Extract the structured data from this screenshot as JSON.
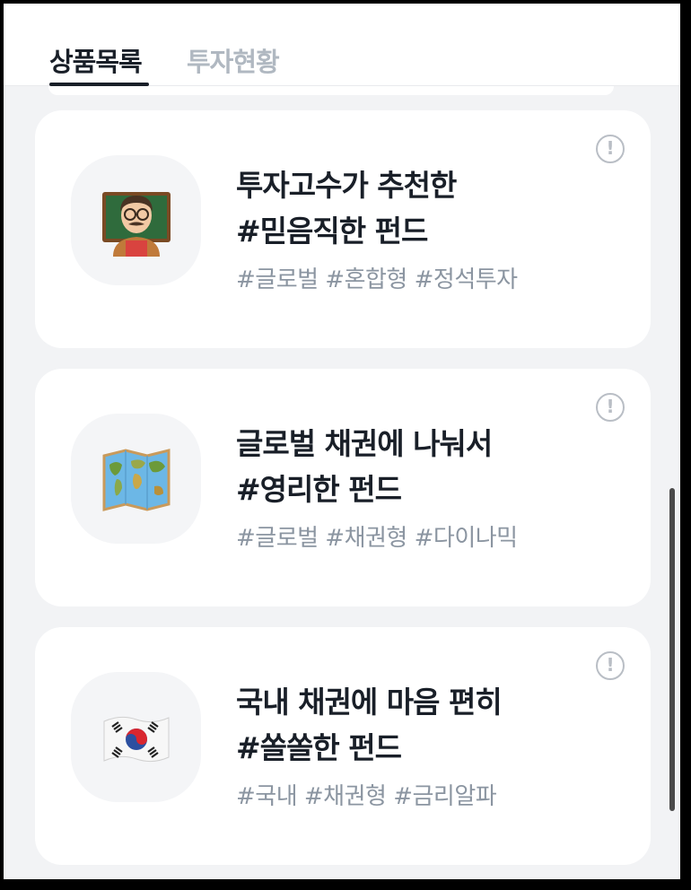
{
  "tabs": [
    {
      "label": "상품목록",
      "active": true
    },
    {
      "label": "투자현황",
      "active": false
    }
  ],
  "info_icon_symbol": "!",
  "funds": [
    {
      "icon": "teacher-emoji-icon",
      "title_line1": "투자고수가 추천한",
      "title_line2": "#믿음직한 펀드",
      "tags": "#글로벌 #혼합형 #정석투자"
    },
    {
      "icon": "world-map-emoji-icon",
      "title_line1": "글로벌 채권에 나눠서",
      "title_line2": "#영리한 펀드",
      "tags": "#글로벌 #채권형 #다이나믹"
    },
    {
      "icon": "korea-flag-emoji-icon",
      "title_line1": "국내 채권에 마음 편히",
      "title_line2": "#쏠쏠한 펀드",
      "tags": "#국내 #채권형 #금리알파"
    }
  ],
  "colors": {
    "background": "#f2f3f5",
    "card": "#ffffff",
    "title": "#191f28",
    "tags": "#8b95a1",
    "inactive_tab": "#b0b8c1"
  }
}
